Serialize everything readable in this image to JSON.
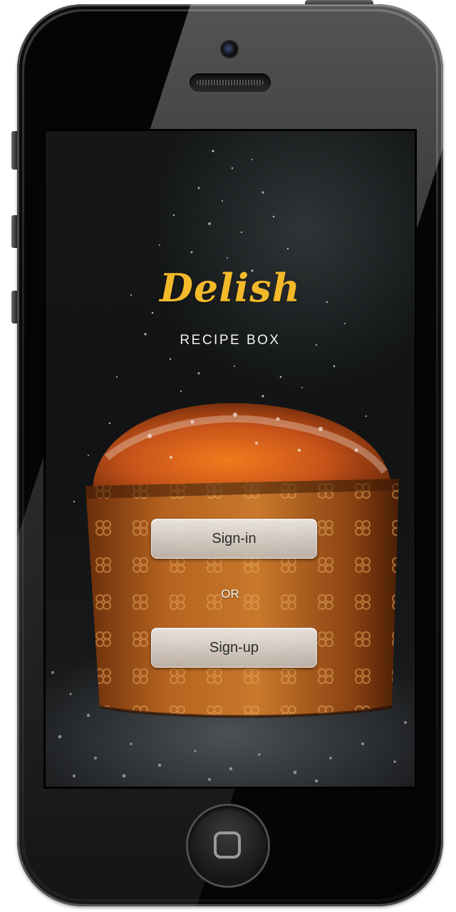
{
  "app": {
    "logo_text": "Delish",
    "subtitle": "RECIPE BOX"
  },
  "auth": {
    "signin_label": "Sign-in",
    "separator_label": "OR",
    "signup_label": "Sign-up"
  },
  "colors": {
    "logo": "#f2b92a",
    "button_bg": "#d6d6d6",
    "button_text": "#2b2b2b",
    "device_frame": "#1c1c1e"
  },
  "icons": {
    "device_camera": "camera-icon",
    "device_speaker": "speaker-icon",
    "device_home": "home-button-icon"
  }
}
